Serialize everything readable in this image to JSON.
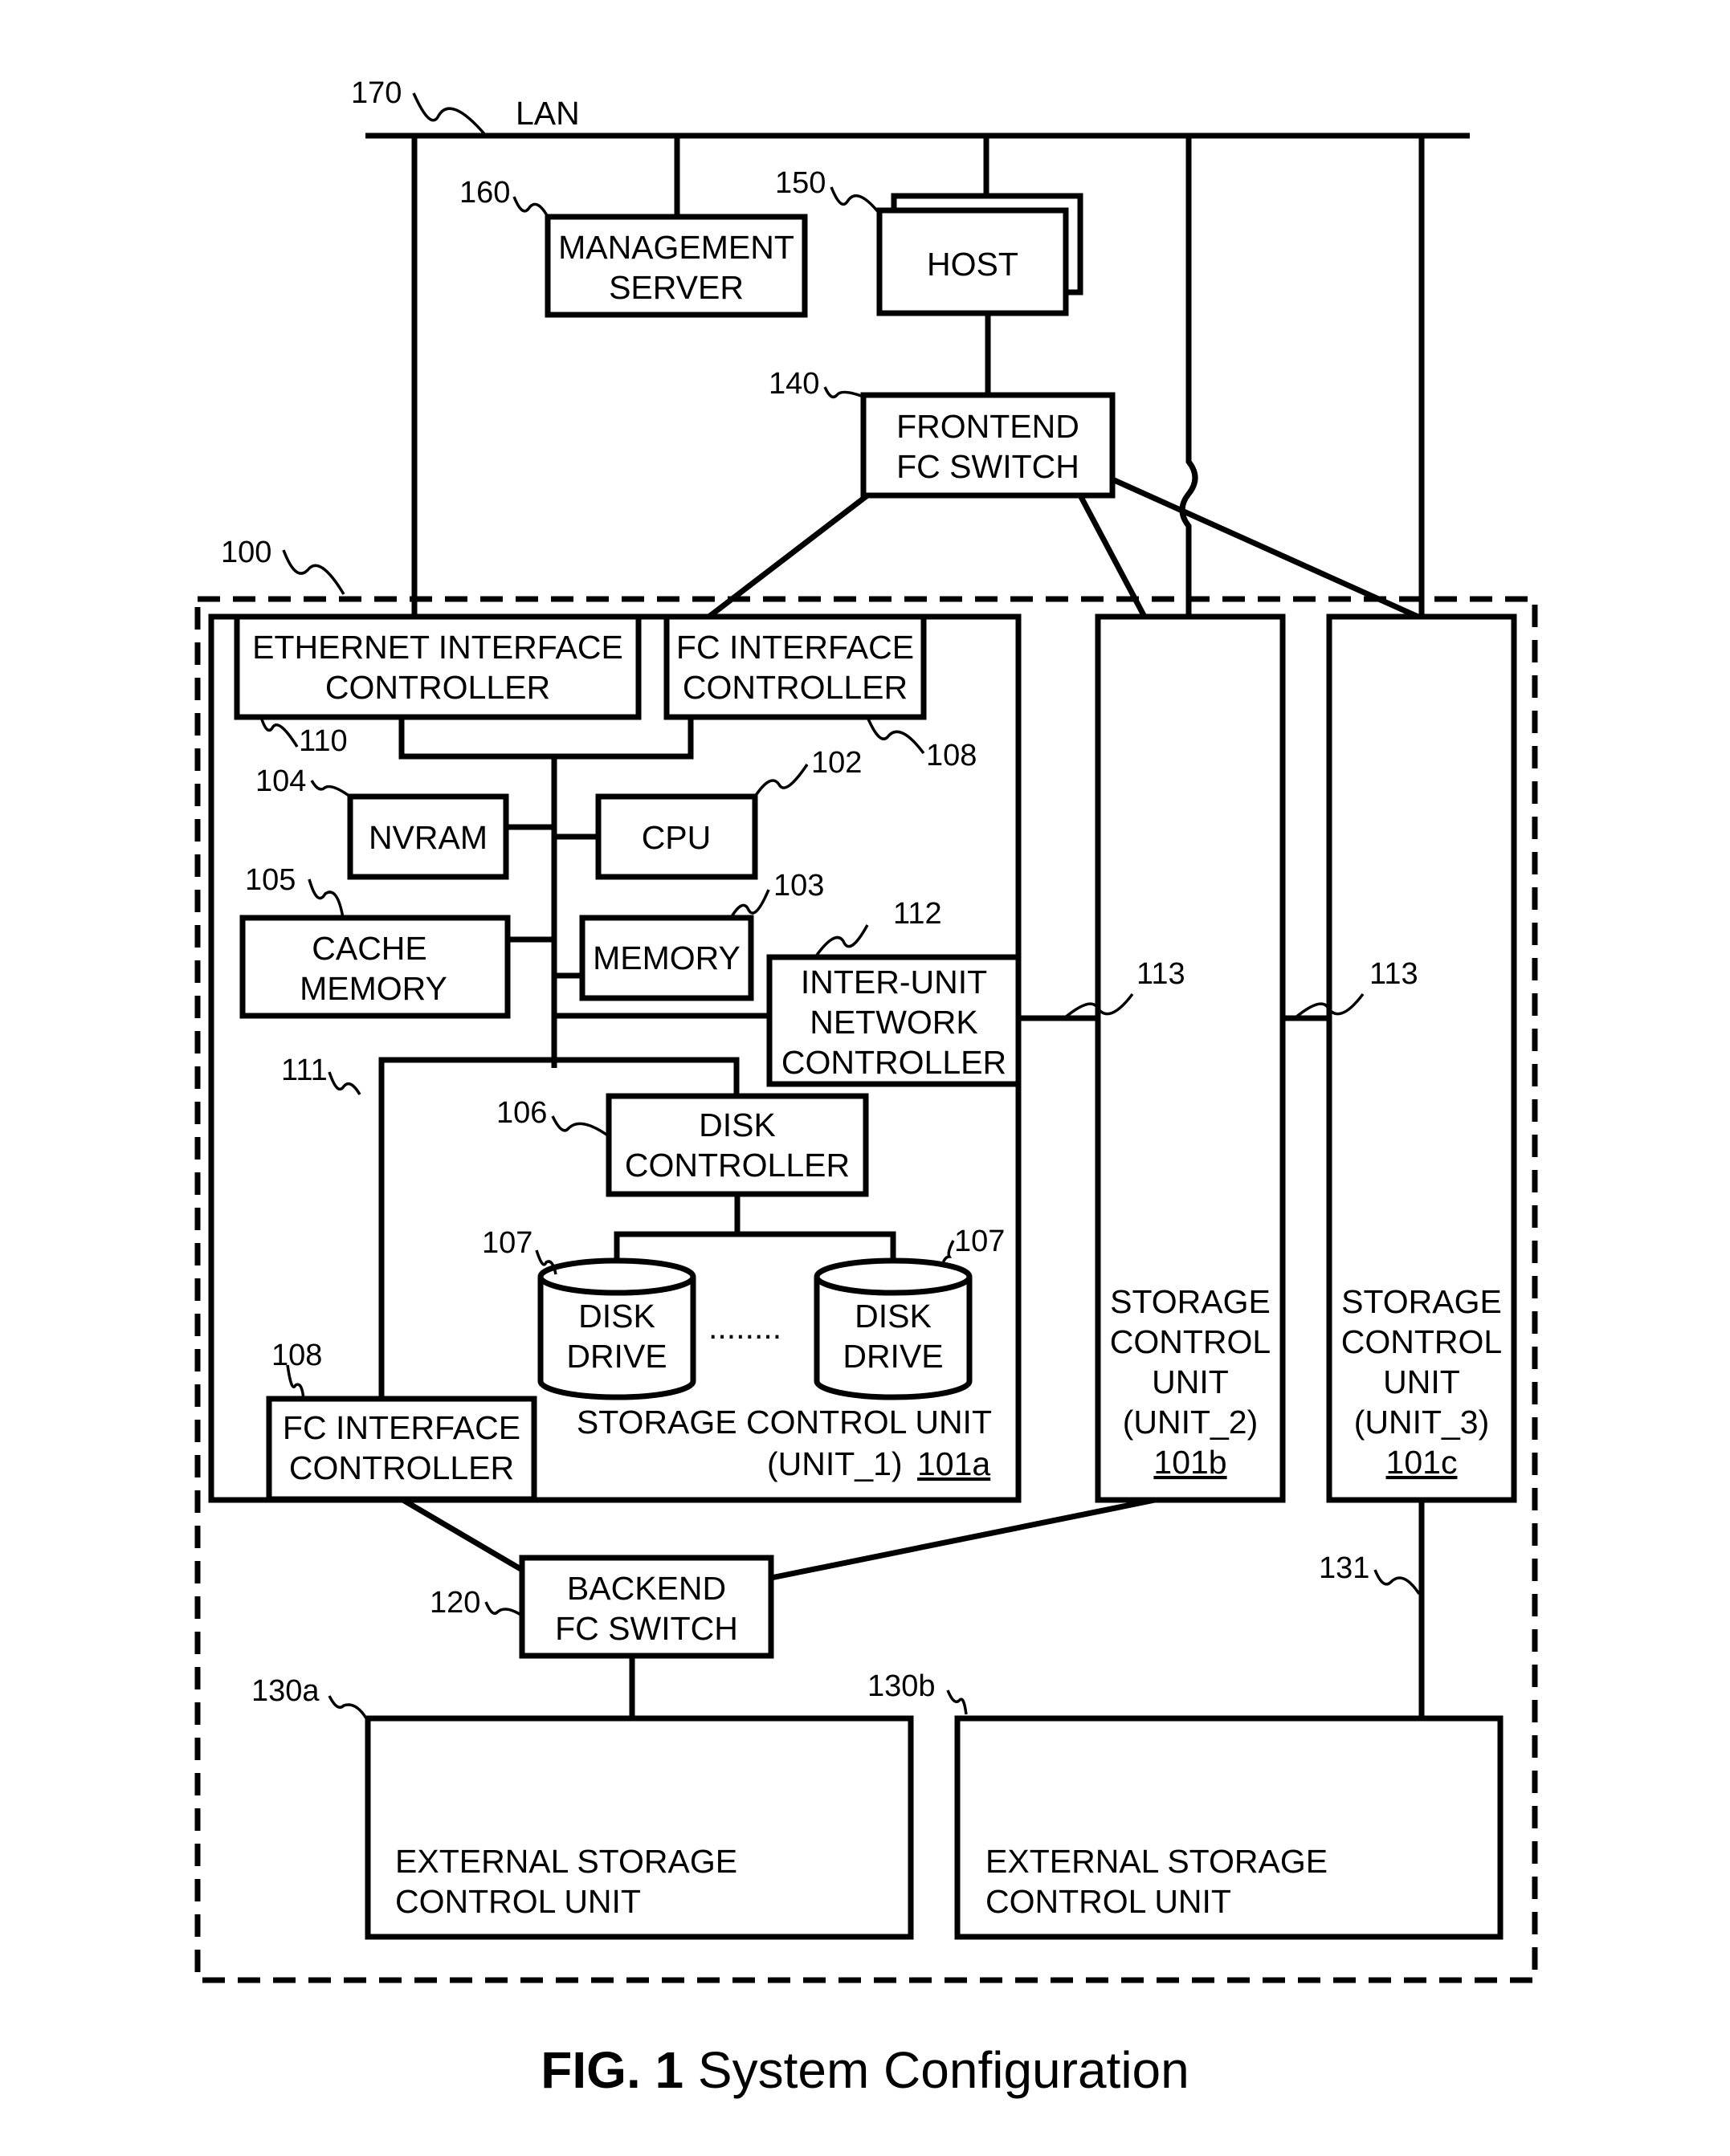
{
  "figure": {
    "caption_bold": "FIG. 1",
    "caption_rest": " System Configuration"
  },
  "lan": {
    "label": "LAN",
    "ref": "170"
  },
  "management_server": {
    "lines": [
      "MANAGEMENT",
      "SERVER"
    ],
    "ref": "160"
  },
  "host": {
    "label": "HOST",
    "ref": "150"
  },
  "frontend_switch": {
    "lines": [
      "FRONTEND",
      "FC SWITCH"
    ],
    "ref": "140"
  },
  "system": {
    "ref": "100"
  },
  "unit1": {
    "title": "STORAGE CONTROL UNIT",
    "subtitle": "(UNIT_1)",
    "id": "101a",
    "ethernet_ctrl": {
      "lines": [
        "ETHERNET INTERFACE",
        "CONTROLLER"
      ],
      "ref": "110"
    },
    "fc_ctrl_top": {
      "lines": [
        "FC INTERFACE",
        "CONTROLLER"
      ],
      "ref": "108"
    },
    "nvram": {
      "label": "NVRAM",
      "ref": "104"
    },
    "cpu": {
      "label": "CPU",
      "ref": "102"
    },
    "cache": {
      "lines": [
        "CACHE",
        "MEMORY"
      ],
      "ref": "105"
    },
    "memory": {
      "label": "MEMORY",
      "ref": "103"
    },
    "inter_unit": {
      "lines": [
        "INTER-UNIT",
        "NETWORK",
        "CONTROLLER"
      ],
      "ref": "112"
    },
    "bus_ref": "111",
    "disk_ctrl": {
      "lines": [
        "DISK",
        "CONTROLLER"
      ],
      "ref": "106"
    },
    "disks": [
      {
        "lines": [
          "DISK",
          "DRIVE"
        ],
        "ref": "107"
      },
      {
        "lines": [
          "DISK",
          "DRIVE"
        ],
        "ref": "107"
      }
    ],
    "ellipsis": "........",
    "fc_ctrl_bottom": {
      "lines": [
        "FC INTERFACE",
        "CONTROLLER"
      ],
      "ref": "108"
    }
  },
  "unit2": {
    "lines": [
      "STORAGE",
      "CONTROL",
      "UNIT",
      "(UNIT_2)"
    ],
    "id": "101b",
    "link_ref": "113"
  },
  "unit3": {
    "lines": [
      "STORAGE",
      "CONTROL",
      "UNIT",
      "(UNIT_3)"
    ],
    "id": "101c",
    "link_ref": "113"
  },
  "backend_switch": {
    "lines": [
      "BACKEND",
      "FC SWITCH"
    ],
    "ref": "120"
  },
  "ext_a": {
    "lines": [
      "EXTERNAL STORAGE",
      "CONTROL UNIT"
    ],
    "ref": "130a"
  },
  "ext_b": {
    "lines": [
      "EXTERNAL STORAGE",
      "CONTROL UNIT"
    ],
    "ref": "130b"
  },
  "ext_link_ref": "131"
}
